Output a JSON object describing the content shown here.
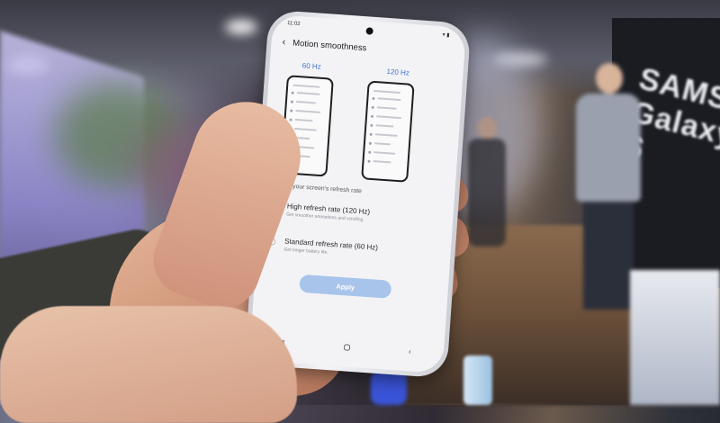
{
  "screen": {
    "status_time": "11:02",
    "header": {
      "back_icon": "back-arrow-icon",
      "title": "Motion smoothness"
    },
    "previews": {
      "left_label": "60 Hz",
      "right_label": "120 Hz"
    },
    "caption": "Adjust your screen's refresh rate",
    "options": [
      {
        "title": "High refresh rate (120 Hz)",
        "description": "Get smoother animations and scrolling.",
        "selected": true
      },
      {
        "title": "Standard refresh rate (60 Hz)",
        "description": "Get longer battery life.",
        "selected": false
      }
    ],
    "apply_label": "Apply",
    "navigation": [
      "recents-icon",
      "home-icon",
      "back-icon"
    ]
  },
  "background": {
    "banner_text": "SAMSUNG Galaxy S"
  },
  "colors": {
    "accent": "#3d6fd6",
    "apply_button": "#a9c4ea",
    "screen_bg": "#f3f3f5"
  }
}
